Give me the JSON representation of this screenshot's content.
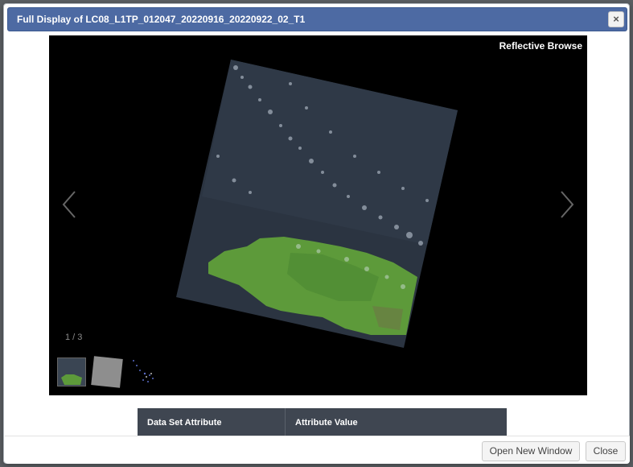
{
  "dialog": {
    "title": "Full Display of LC08_L1TP_012047_20220916_20220922_02_T1",
    "close_icon": "×"
  },
  "viewer": {
    "label": "Reflective Browse",
    "counter": "1 / 3",
    "prev_icon": "chevron-left-icon",
    "next_icon": "chevron-right-icon",
    "thumbnails": [
      "reflective-browse",
      "thermal-browse",
      "quality-browse"
    ]
  },
  "attributes_table": {
    "headers": [
      "Data Set Attribute",
      "Attribute Value"
    ]
  },
  "footer": {
    "open_new_window_label": "Open New Window",
    "close_label": "Close"
  },
  "colors": {
    "titlebar": "#4d6aa3",
    "table_header": "#3f4651",
    "land": "#5d9a3a",
    "ocean": "#2a3340"
  }
}
